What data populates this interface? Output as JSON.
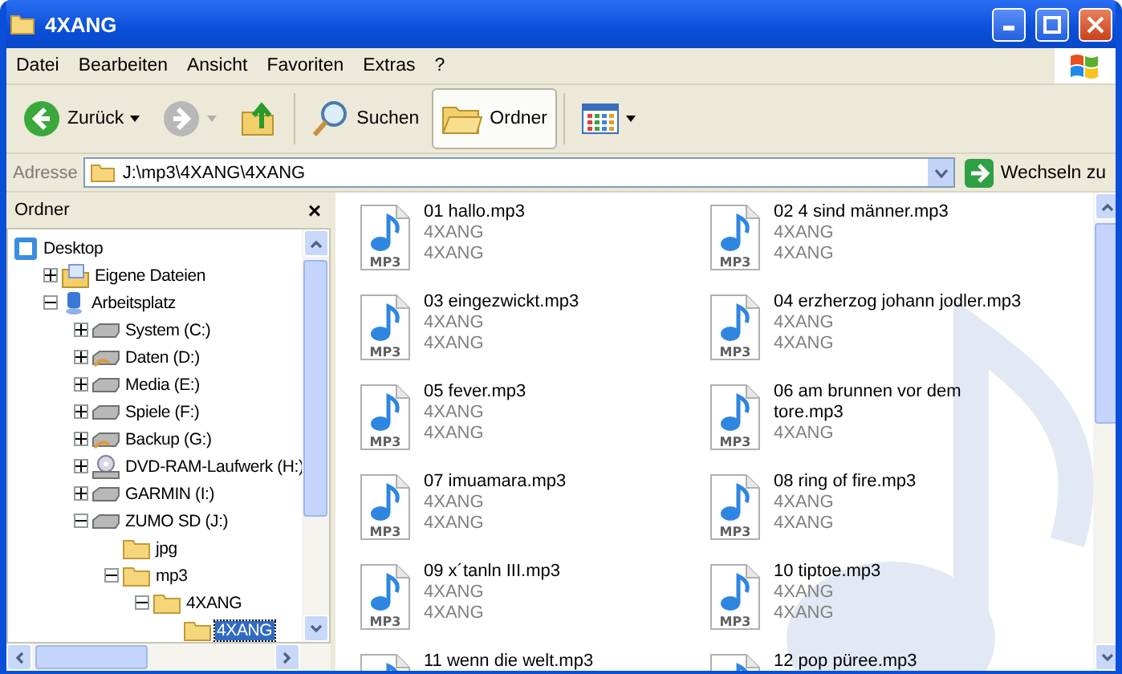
{
  "window": {
    "title": "4XANG"
  },
  "menu": [
    "Datei",
    "Bearbeiten",
    "Ansicht",
    "Favoriten",
    "Extras",
    "?"
  ],
  "toolbar": [
    {
      "kind": "back",
      "label": "Zurück",
      "selected": false
    },
    {
      "kind": "forward",
      "selected": false
    },
    {
      "kind": "up",
      "selected": false
    },
    {
      "kind": "search",
      "label": "Suchen",
      "selected": false
    },
    {
      "kind": "folders",
      "label": "Ordner",
      "selected": true
    },
    {
      "kind": "views",
      "selected": false
    }
  ],
  "address": {
    "label": "Adresse",
    "value": "J:\\mp3\\4XANG\\4XANG",
    "go": "Wechseln zu"
  },
  "folder_pane": {
    "title": "Ordner",
    "close": "×",
    "tree": [
      {
        "label": "Desktop",
        "kind": "desktop",
        "selected": false,
        "children": [
          {
            "label": "Eigene Dateien",
            "kind": "documents",
            "expanded": false,
            "selected": false
          },
          {
            "label": "Arbeitsplatz",
            "kind": "computer",
            "expanded": true,
            "selected": false,
            "children": [
              {
                "label": "System (C:)",
                "kind": "drive",
                "expanded": false,
                "selected": false
              },
              {
                "label": "Daten (D:)",
                "kind": "shared",
                "expanded": false,
                "selected": false
              },
              {
                "label": "Media (E:)",
                "kind": "drive",
                "expanded": false,
                "selected": false
              },
              {
                "label": "Spiele (F:)",
                "kind": "drive",
                "expanded": false,
                "selected": false
              },
              {
                "label": "Backup (G:)",
                "kind": "shared",
                "expanded": false,
                "selected": false
              },
              {
                "label": "DVD-RAM-Laufwerk (H:)",
                "kind": "dvd",
                "expanded": false,
                "selected": false
              },
              {
                "label": "GARMIN (I:)",
                "kind": "drive",
                "expanded": false,
                "selected": false
              },
              {
                "label": "ZUMO SD (J:)",
                "kind": "drive",
                "expanded": true,
                "selected": false,
                "children": [
                  {
                    "label": "jpg",
                    "kind": "folder",
                    "selected": false
                  },
                  {
                    "label": "mp3",
                    "kind": "folder",
                    "expanded": true,
                    "selected": false,
                    "children": [
                      {
                        "label": "4XANG",
                        "kind": "folder",
                        "expanded": true,
                        "selected": false,
                        "children": [
                          {
                            "label": "4XANG",
                            "kind": "folder",
                            "selected": true
                          }
                        ]
                      }
                    ]
                  }
                ]
              }
            ]
          }
        ]
      }
    ]
  },
  "files": [
    {
      "name": "01 hallo.mp3",
      "icon_label": "MP3",
      "details": [
        "4XANG",
        "4XANG"
      ]
    },
    {
      "name": "02 4 sind männer.mp3",
      "icon_label": "MP3",
      "details": [
        "4XANG",
        "4XANG"
      ]
    },
    {
      "name": "03 eingezwickt.mp3",
      "icon_label": "MP3",
      "details": [
        "4XANG",
        "4XANG"
      ]
    },
    {
      "name": "04 erzherzog johann jodler.mp3",
      "icon_label": "MP3",
      "details": [
        "4XANG",
        "4XANG"
      ]
    },
    {
      "name": "05 fever.mp3",
      "icon_label": "MP3",
      "details": [
        "4XANG",
        "4XANG"
      ]
    },
    {
      "name": "06 am brunnen vor dem tore.mp3",
      "icon_label": "MP3",
      "details": [
        "4XANG"
      ]
    },
    {
      "name": "07 imuamara.mp3",
      "icon_label": "MP3",
      "details": [
        "4XANG",
        "4XANG"
      ]
    },
    {
      "name": "08 ring of fire.mp3",
      "icon_label": "MP3",
      "details": [
        "4XANG",
        "4XANG"
      ]
    },
    {
      "name": "09 x´tanln III.mp3",
      "icon_label": "MP3",
      "details": [
        "4XANG",
        "4XANG"
      ]
    },
    {
      "name": "10 tiptoe.mp3",
      "icon_label": "MP3",
      "details": [
        "4XANG",
        "4XANG"
      ]
    },
    {
      "name": "11 wenn die welt.mp3"
    },
    {
      "name": "12 pop püree.mp3"
    }
  ]
}
